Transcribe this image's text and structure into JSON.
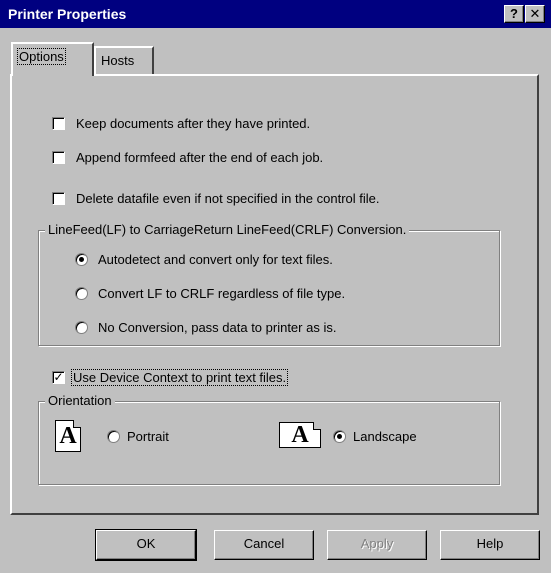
{
  "window": {
    "title": "Printer Properties",
    "help_button": "?",
    "close_button": "✕"
  },
  "tabs": [
    {
      "label": "Options",
      "selected": true
    },
    {
      "label": "Hosts",
      "selected": false
    }
  ],
  "options": {
    "keep_documents": {
      "label": "Keep documents after they have printed.",
      "checked": false
    },
    "append_formfeed": {
      "label": "Append formfeed after the end of each job.",
      "checked": false
    },
    "delete_datafile": {
      "label": "Delete datafile even if not specified in the control file.",
      "checked": false
    }
  },
  "conversion_group": {
    "legend": "LineFeed(LF) to CarriageReturn LineFeed(CRLF) Conversion.",
    "options": [
      {
        "label": "Autodetect and convert only for text files.",
        "selected": true
      },
      {
        "label": "Convert LF to CRLF regardless of file type.",
        "selected": false
      },
      {
        "label": "No Conversion, pass data to printer as is.",
        "selected": false
      }
    ]
  },
  "device_context": {
    "label": "Use Device Context to print text files.",
    "checked": true
  },
  "orientation_group": {
    "legend": "Orientation",
    "portrait": {
      "label": "Portrait",
      "icon_letter": "A",
      "icon": "portrait-page-icon",
      "selected": false
    },
    "landscape": {
      "label": "Landscape",
      "icon_letter": "A",
      "icon": "landscape-page-icon",
      "selected": true
    }
  },
  "buttons": {
    "ok": "OK",
    "cancel": "Cancel",
    "apply": "Apply",
    "help": "Help"
  }
}
